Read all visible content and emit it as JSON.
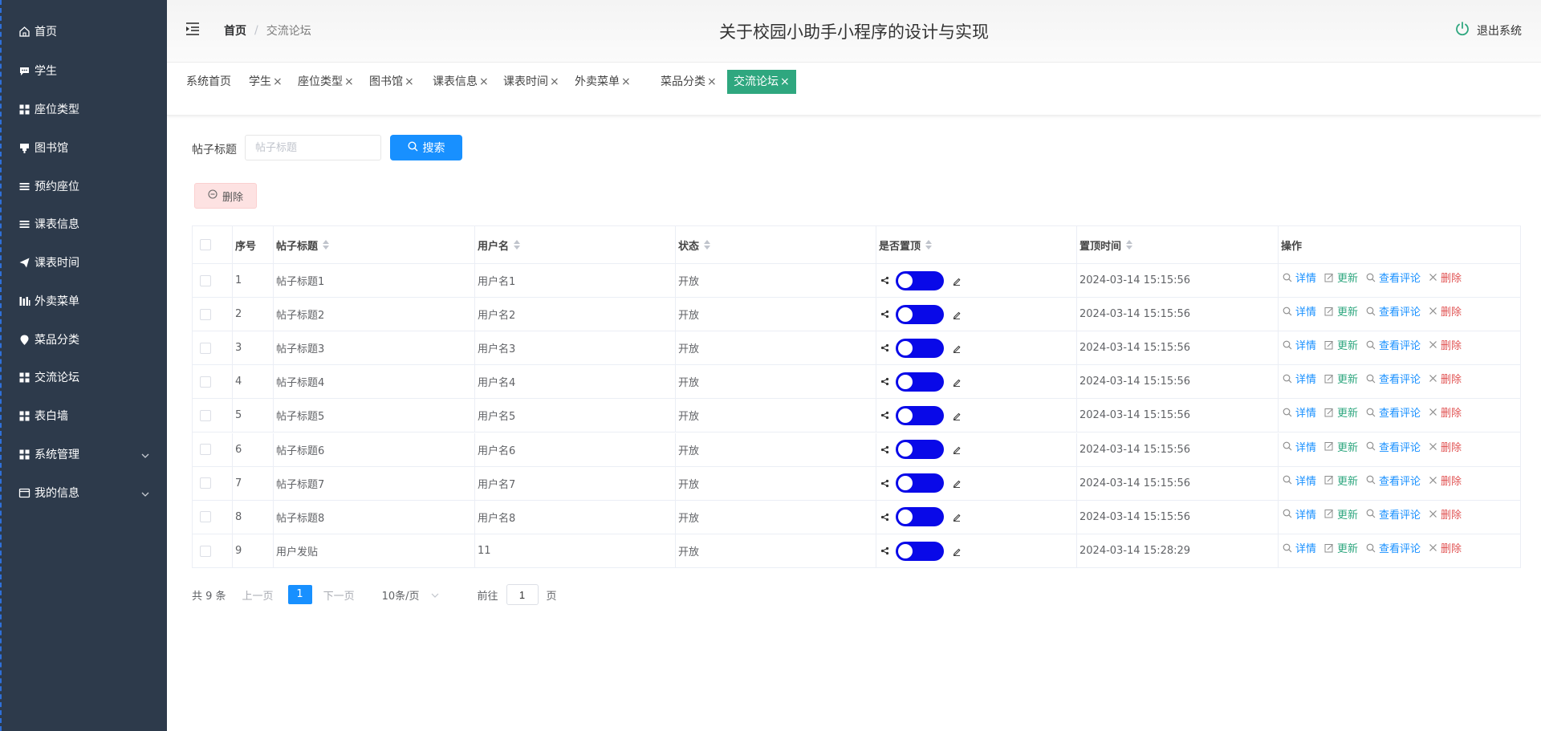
{
  "sidebar": {
    "items": [
      {
        "label": "首页",
        "icon": "home-icon"
      },
      {
        "label": "学生",
        "icon": "chat-icon"
      },
      {
        "label": "座位类型",
        "icon": "grid-icon"
      },
      {
        "label": "图书馆",
        "icon": "stand-icon"
      },
      {
        "label": "预约座位",
        "icon": "list-icon"
      },
      {
        "label": "课表信息",
        "icon": "list-icon"
      },
      {
        "label": "课表时间",
        "icon": "send-icon"
      },
      {
        "label": "外卖菜单",
        "icon": "bars-icon"
      },
      {
        "label": "菜品分类",
        "icon": "location-icon"
      },
      {
        "label": "交流论坛",
        "icon": "grid-icon"
      },
      {
        "label": "表白墙",
        "icon": "grid-icon"
      },
      {
        "label": "系统管理",
        "icon": "grid-icon",
        "has_submenu": true
      },
      {
        "label": "我的信息",
        "icon": "card-icon",
        "has_submenu": true
      }
    ]
  },
  "header": {
    "breadcrumb_home": "首页",
    "breadcrumb_separator": "/",
    "breadcrumb_current": "交流论坛",
    "title": "关于校园小助手小程序的设计与实现",
    "logout_label": "退出系统",
    "logout_icon_color": "#2fa77f"
  },
  "tabs": [
    {
      "label": "系统首页",
      "closable": false,
      "active": false
    },
    {
      "label": "学生",
      "closable": true,
      "active": false
    },
    {
      "label": "座位类型",
      "closable": true,
      "active": false
    },
    {
      "label": "图书馆",
      "closable": true,
      "active": false
    },
    {
      "label": "课表信息",
      "closable": true,
      "active": false
    },
    {
      "label": "课表时间",
      "closable": true,
      "active": false
    },
    {
      "label": "外卖菜单",
      "closable": true,
      "active": false
    },
    {
      "label": "菜品分类",
      "closable": true,
      "active": false
    },
    {
      "label": "交流论坛",
      "closable": true,
      "active": true
    }
  ],
  "tab_close_glyph": "×",
  "search": {
    "label": "帖子标题",
    "placeholder": "帖子标题",
    "value": "",
    "button_label": "搜索"
  },
  "delete_button_label": "删除",
  "table": {
    "columns": [
      "序号",
      "帖子标题",
      "用户名",
      "状态",
      "是否置顶",
      "置顶时间",
      "操作"
    ],
    "rows": [
      {
        "index": "1",
        "title": "帖子标题1",
        "user": "用户名1",
        "status": "开放",
        "pinned": true,
        "pin_time": "2024-03-14 15:15:56"
      },
      {
        "index": "2",
        "title": "帖子标题2",
        "user": "用户名2",
        "status": "开放",
        "pinned": true,
        "pin_time": "2024-03-14 15:15:56"
      },
      {
        "index": "3",
        "title": "帖子标题3",
        "user": "用户名3",
        "status": "开放",
        "pinned": true,
        "pin_time": "2024-03-14 15:15:56"
      },
      {
        "index": "4",
        "title": "帖子标题4",
        "user": "用户名4",
        "status": "开放",
        "pinned": true,
        "pin_time": "2024-03-14 15:15:56"
      },
      {
        "index": "5",
        "title": "帖子标题5",
        "user": "用户名5",
        "status": "开放",
        "pinned": true,
        "pin_time": "2024-03-14 15:15:56"
      },
      {
        "index": "6",
        "title": "帖子标题6",
        "user": "用户名6",
        "status": "开放",
        "pinned": true,
        "pin_time": "2024-03-14 15:15:56"
      },
      {
        "index": "7",
        "title": "帖子标题7",
        "user": "用户名7",
        "status": "开放",
        "pinned": true,
        "pin_time": "2024-03-14 15:15:56"
      },
      {
        "index": "8",
        "title": "帖子标题8",
        "user": "用户名8",
        "status": "开放",
        "pinned": true,
        "pin_time": "2024-03-14 15:15:56"
      },
      {
        "index": "9",
        "title": "用户发贴",
        "user": "11",
        "status": "开放",
        "pinned": true,
        "pin_time": "2024-03-14 15:28:29"
      }
    ],
    "actions": {
      "detail": "详情",
      "update": "更新",
      "comments": "查看评论",
      "delete": "删除"
    },
    "switch_color": "#0909e8"
  },
  "pagination": {
    "total_text": "共 9 条",
    "prev_label": "上一页",
    "current_page": "1",
    "next_label": "下一页",
    "page_size_label": "10条/页",
    "goto_prefix": "前往",
    "goto_value": "1",
    "goto_suffix": "页"
  },
  "colors": {
    "sidebar_bg": "#2d3a4b",
    "accent_green": "#2fa77f",
    "primary_blue": "#1890ff",
    "danger": "#e05252"
  }
}
